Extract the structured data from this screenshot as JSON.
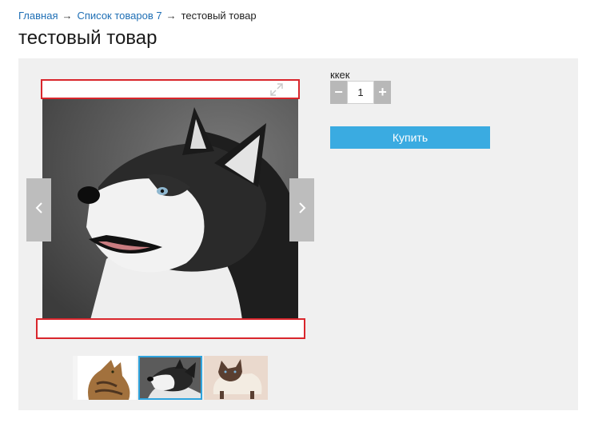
{
  "breadcrumb": {
    "items": [
      {
        "label": "Главная"
      },
      {
        "label": "Список товаров 7"
      }
    ],
    "separator": "→",
    "current": "тестовый товар"
  },
  "page": {
    "title": "тестовый товар"
  },
  "gallery": {
    "main_photo": "husky-dog-photo",
    "thumbnails": [
      "bengal-cat-photo",
      "husky-dog-photo",
      "siamese-cat-photo"
    ],
    "selected_thumbnail_index": 1,
    "selected_border_color": "#2fa4de",
    "highlight_color": "#d9262c"
  },
  "purchase": {
    "quantity_label": "ккек",
    "quantity_value": "1",
    "minus_label": "−",
    "plus_label": "+",
    "buy_label": "Купить",
    "buy_color": "#3aabe1"
  }
}
